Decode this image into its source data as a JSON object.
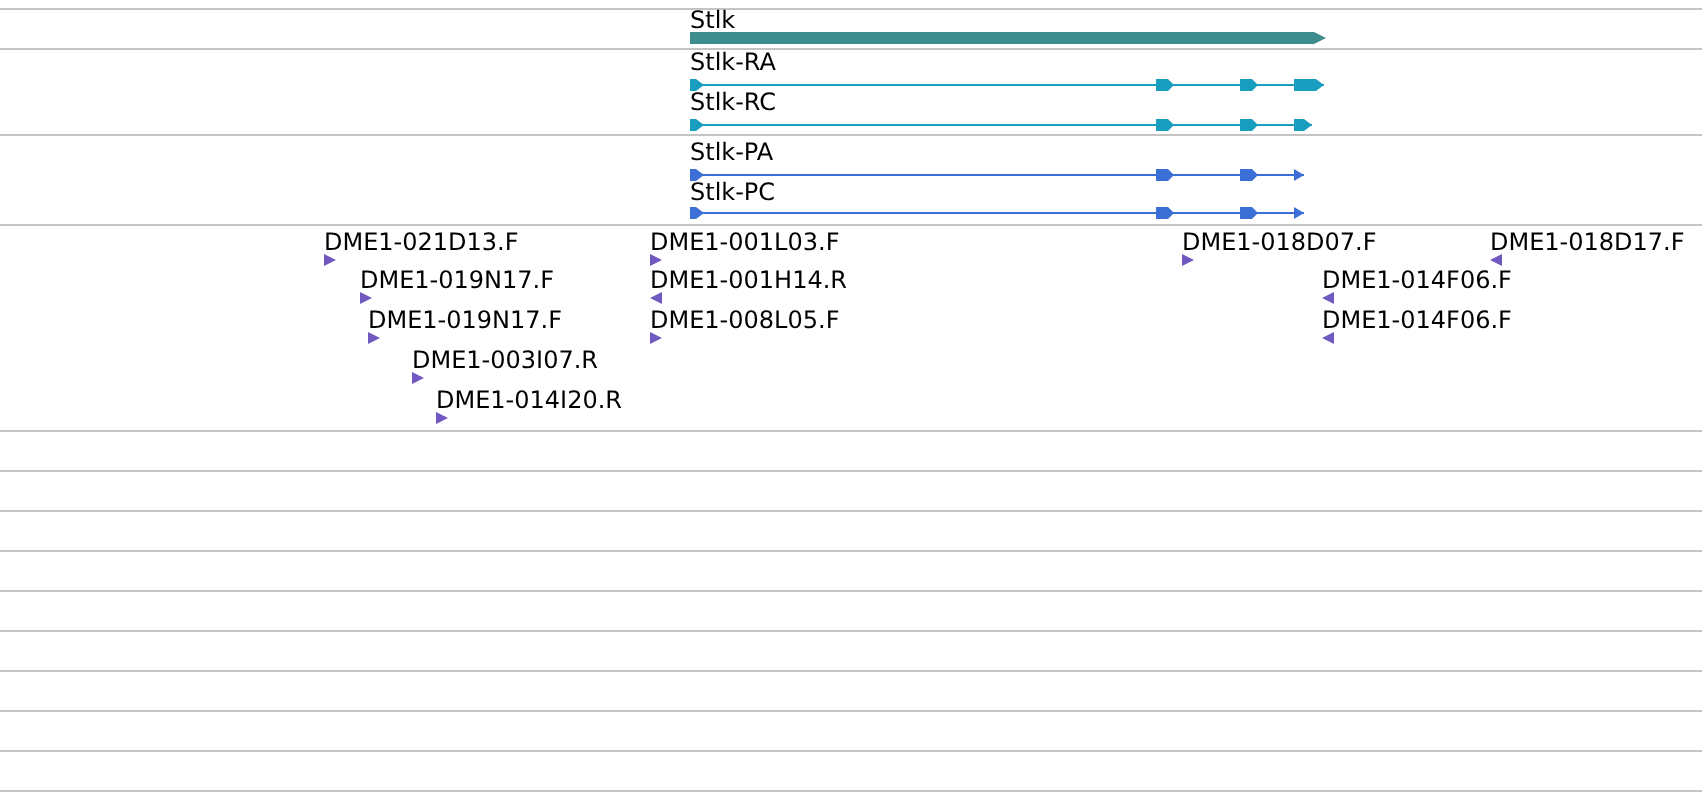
{
  "tracks": [
    {
      "kind": "gene",
      "features": [
        {
          "label": "Stlk"
        }
      ]
    },
    {
      "kind": "transcript",
      "features": [
        {
          "label": "Stlk-RA"
        },
        {
          "label": "Stlk-RC"
        }
      ]
    },
    {
      "kind": "protein",
      "features": [
        {
          "label": "Stlk-PA"
        },
        {
          "label": "Stlk-PC"
        }
      ]
    },
    {
      "kind": "est",
      "features": [
        {
          "label": "DME1-021D13.F",
          "reverse": false
        },
        {
          "label": "DME1-019N17.F",
          "reverse": false
        },
        {
          "label": "DME1-019N17.F",
          "reverse": false
        },
        {
          "label": "DME1-003I07.R",
          "reverse": false
        },
        {
          "label": "DME1-014I20.R",
          "reverse": false
        },
        {
          "label": "DME1-001L03.F",
          "reverse": false
        },
        {
          "label": "DME1-001H14.R",
          "reverse": true
        },
        {
          "label": "DME1-008L05.F",
          "reverse": false
        },
        {
          "label": "DME1-018D07.F",
          "reverse": false
        },
        {
          "label": "DME1-018D17.F",
          "reverse": true
        },
        {
          "label": "DME1-014F06.F",
          "reverse": true
        },
        {
          "label": "DME1-014F06.F",
          "reverse": true
        }
      ]
    },
    {
      "kind": "empty"
    },
    {
      "kind": "empty"
    },
    {
      "kind": "empty"
    },
    {
      "kind": "empty"
    },
    {
      "kind": "empty"
    },
    {
      "kind": "empty"
    },
    {
      "kind": "empty"
    },
    {
      "kind": "empty"
    },
    {
      "kind": "empty"
    }
  ]
}
